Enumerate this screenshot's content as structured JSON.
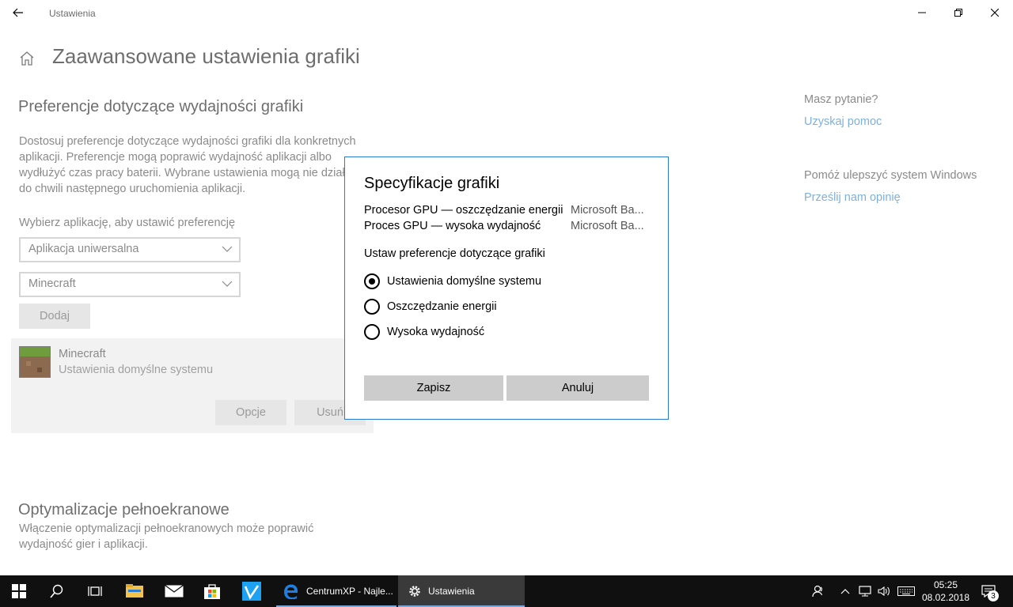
{
  "window": {
    "title": "Ustawienia"
  },
  "page": {
    "title": "Zaawansowane ustawienia grafiki",
    "section_title": "Preferencje dotyczące wydajności grafiki",
    "description": "Dostosuj preferencje dotyczące wydajności grafiki dla konkretnych aplikacji. Preferencje mogą poprawić wydajność aplikacji albo wydłużyć czas pracy baterii. Wybrane ustawienia mogą nie działać do chwili następnego uruchomienia aplikacji.",
    "choose_label": "Wybierz aplikację, aby ustawić preferencję",
    "app_type_value": "Aplikacja uniwersalna",
    "app_value": "Minecraft",
    "add_button": "Dodaj",
    "entry": {
      "name": "Minecraft",
      "status": "Ustawienia domyślne systemu",
      "options_button": "Opcje",
      "remove_button": "Usuń"
    },
    "fullscreen_title": "Optymalizacje pełnoekranowe",
    "fullscreen_desc": "Włączenie optymalizacji pełnoekranowych może poprawić wydajność gier i aplikacji."
  },
  "sidebar": {
    "question": "Masz pytanie?",
    "help_link": "Uzyskaj pomoc",
    "improve": "Pomóż ulepszyć system Windows",
    "feedback_link": "Prześlij nam opinię"
  },
  "dialog": {
    "title": "Specyfikacje grafiki",
    "specs": [
      {
        "label": "Procesor GPU — oszczędzanie energii",
        "value": "Microsoft Ba..."
      },
      {
        "label": "Proces GPU — wysoka wydajność",
        "value": "Microsoft Ba..."
      }
    ],
    "pref_label": "Ustaw preferencje dotyczące grafiki",
    "options": [
      {
        "label": "Ustawienia domyślne systemu",
        "checked": true
      },
      {
        "label": "Oszczędzanie energii",
        "checked": false
      },
      {
        "label": "Wysoka wydajność",
        "checked": false
      }
    ],
    "save_button": "Zapisz",
    "cancel_button": "Anuluj"
  },
  "taskbar": {
    "edge_task": "CentrumXP - Najle...",
    "settings_task": "Ustawienia",
    "time": "05:25",
    "date": "08.02.2018",
    "notification_count": "3",
    "accent": "#7aa7d8"
  }
}
